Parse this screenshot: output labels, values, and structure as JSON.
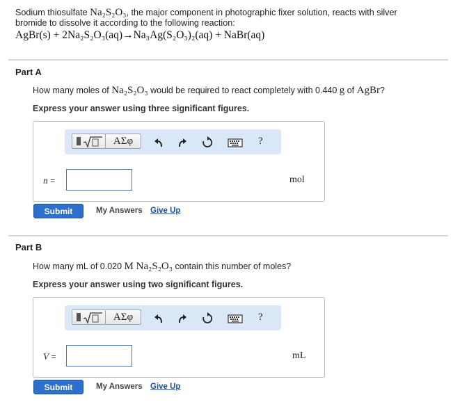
{
  "intro": {
    "text_before": "Sodium thiosulfate ",
    "compound": "Na₂S₂O₃",
    "text_after": ", the major component in photographic fixer solution, reacts with silver",
    "line2": "bromide to dissolve it according to the following reaction:"
  },
  "reaction": "AgBr(s) + 2Na₂S₂O₃(aq)→Na₃Ag(S₂O₃)₂(aq) + NaBr(aq)",
  "toolbar": {
    "greek_label": "ΑΣφ",
    "help_label": "?"
  },
  "part_a": {
    "title": "Part A",
    "question_start": "How many moles of ",
    "question_compound": "Na₂S₂O₃",
    "question_mid": " would be required to react completely with 0.440 ",
    "question_unit": "g",
    "question_of": " of ",
    "question_compound2": "AgBr",
    "question_end": "?",
    "instruction": "Express your answer using three significant figures.",
    "var_symbol": "n",
    "var_eq": " =",
    "input_value": "",
    "unit": "mol",
    "submit_label": "Submit",
    "my_answers_label": "My Answers",
    "give_up_label": "Give Up"
  },
  "part_b": {
    "title": "Part B",
    "question_start": "How many mL of 0.020 ",
    "question_unit": "M",
    "question_compound": " Na₂S₂O₃",
    "question_end": " contain this number of moles?",
    "instruction": "Express your answer using two significant figures.",
    "var_symbol": "V",
    "var_eq": " =",
    "input_value": "",
    "unit": "mL",
    "submit_label": "Submit",
    "my_answers_label": "My Answers",
    "give_up_label": "Give Up"
  },
  "colors": {
    "toolbar_bg": "#d9e7f7",
    "submit_bg": "#2f6fcc",
    "input_border": "#3a78c9",
    "link": "#1a4fa8"
  },
  "icons": [
    "matrix-sqrt-icon",
    "undo-icon",
    "redo-icon",
    "reset-icon",
    "keyboard-icon",
    "help-icon"
  ]
}
